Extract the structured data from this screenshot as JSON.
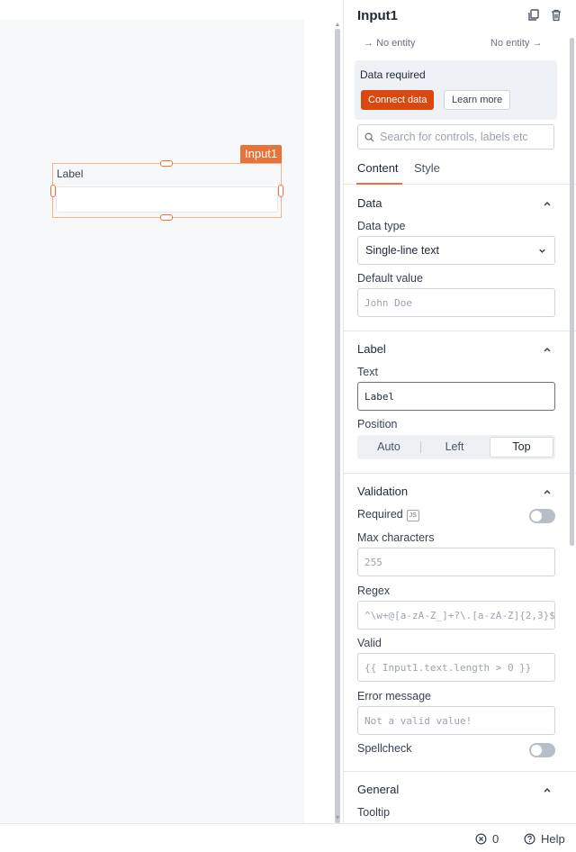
{
  "canvas": {
    "widget_tag": "Input1",
    "widget_label": "Label"
  },
  "panel": {
    "title": "Input1",
    "entity_left": "No entity",
    "entity_right": "No entity",
    "data_required": {
      "title": "Data required",
      "connect_label": "Connect data",
      "learn_label": "Learn more"
    },
    "search_placeholder": "Search for controls, labels etc",
    "tabs": [
      {
        "label": "Content",
        "active": true
      },
      {
        "label": "Style",
        "active": false
      }
    ],
    "data_section": {
      "title": "Data",
      "data_type_label": "Data type",
      "data_type_value": "Single-line text",
      "default_value_label": "Default value",
      "default_value_placeholder": "John Doe"
    },
    "label_section": {
      "title": "Label",
      "text_label": "Text",
      "text_value": "Label",
      "position_label": "Position",
      "position_options": [
        "Auto",
        "Left",
        "Top"
      ],
      "position_selected": "Top"
    },
    "validation_section": {
      "title": "Validation",
      "required_label": "Required",
      "js_badge": "JS",
      "required_on": false,
      "max_chars_label": "Max characters",
      "max_chars_placeholder": "255",
      "regex_label": "Regex",
      "regex_placeholder": "^\\w+@[a-zA-Z_]+?\\.[a-zA-Z]{2,3}$",
      "valid_label": "Valid",
      "valid_placeholder": "{{ Input1.text.length > 0 }}",
      "error_label": "Error message",
      "error_placeholder": "Not a valid value!",
      "spellcheck_label": "Spellcheck",
      "spellcheck_on": false
    },
    "general_section": {
      "title": "General",
      "tooltip_label": "Tooltip"
    }
  },
  "statusbar": {
    "errors_count": "0",
    "help_label": "Help"
  },
  "colors": {
    "accent": "#e8733a",
    "connect_button": "#d9480f"
  }
}
